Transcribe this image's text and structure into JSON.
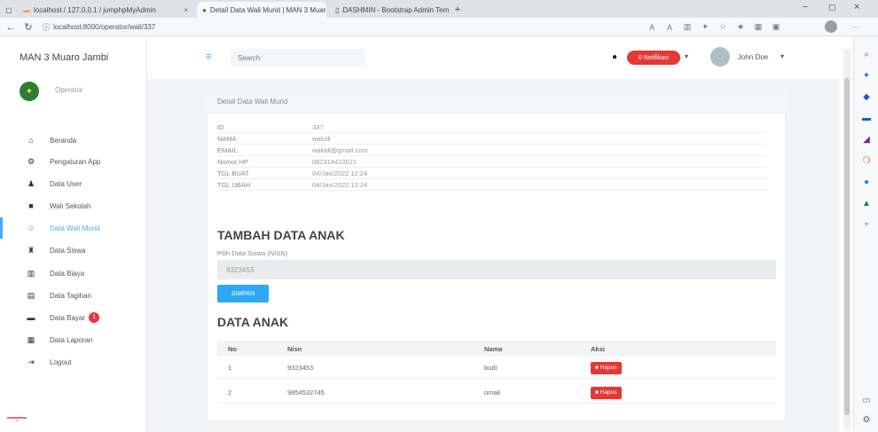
{
  "browser": {
    "tabs": [
      {
        "label": "localhost / 127.0.0.1 / jumphpMyAdmin"
      },
      {
        "label": "Detail Data Wali Murid | MAN 3 Muaro Jambi"
      },
      {
        "label": "DASHMIN - Bootstrap Admin Template"
      }
    ],
    "url": "localhost:8000/operator/wali/337",
    "new_tab": "+",
    "window_controls": [
      "−",
      "▢",
      "×"
    ]
  },
  "sidebar": {
    "brand": "MAN 3 Muaro Jambi",
    "role": "Operator",
    "items": [
      {
        "label": "Beranda",
        "icon": "home-icon",
        "glyph": "⌂"
      },
      {
        "label": "Pengaturan App",
        "icon": "gear-icon",
        "glyph": "⚙"
      },
      {
        "label": "Data User",
        "icon": "user-icon",
        "glyph": "♟"
      },
      {
        "label": "Wali Sekolah",
        "icon": "school-icon",
        "glyph": "■"
      },
      {
        "label": "Data Wali Murid",
        "icon": "parent-icon",
        "glyph": "☺"
      },
      {
        "label": "Data Siswa",
        "icon": "student-icon",
        "glyph": "♜"
      },
      {
        "label": "Data Biaya",
        "icon": "chart-icon",
        "glyph": "▥"
      },
      {
        "label": "Data Tagihan",
        "icon": "invoice-icon",
        "glyph": "▤"
      },
      {
        "label": "Data Bayar",
        "icon": "payment-icon",
        "glyph": "▬",
        "badge": "1"
      },
      {
        "label": "Data Laporan",
        "icon": "report-icon",
        "glyph": "▦"
      },
      {
        "label": "Logout",
        "icon": "logout-icon",
        "glyph": "⇥"
      }
    ]
  },
  "topbar": {
    "search_placeholder": "Search",
    "notification_label": "0 Notifikasi",
    "user_name": "John Doe"
  },
  "card": {
    "title": "Detail Data Wali Murid",
    "details": [
      {
        "key": "ID",
        "value": "337"
      },
      {
        "key": "NAMA",
        "value": "wakidi"
      },
      {
        "key": "EMAIL",
        "value": "wakidi@gmail.com"
      },
      {
        "key": "Nomor HP",
        "value": "082314423521"
      },
      {
        "key": "TGL BUAT",
        "value": "04/Jan/2022 12:24"
      },
      {
        "key": "TGL UBAH",
        "value": "04/Jan/2022 12:24"
      }
    ],
    "tambah_heading": "TAMBAH DATA ANAK",
    "pilih_label": "Pilih Data Siswa (NISN)",
    "nisn_value": "9323453",
    "simpan_label": "SIMPAN",
    "data_heading": "DATA ANAK",
    "table": {
      "headers": [
        "No",
        "Nisn",
        "Nama",
        "Aksi"
      ],
      "rows": [
        {
          "no": "1",
          "nisn": "9323453",
          "nama": "budi",
          "aksi": "Hapus"
        },
        {
          "no": "2",
          "nisn": "9854532745",
          "nama": "omak",
          "aksi": "Hapus"
        }
      ]
    }
  },
  "colors": {
    "accent": "#4aa8ff",
    "danger": "#e53935",
    "primary_button": "#2ea8f5"
  }
}
